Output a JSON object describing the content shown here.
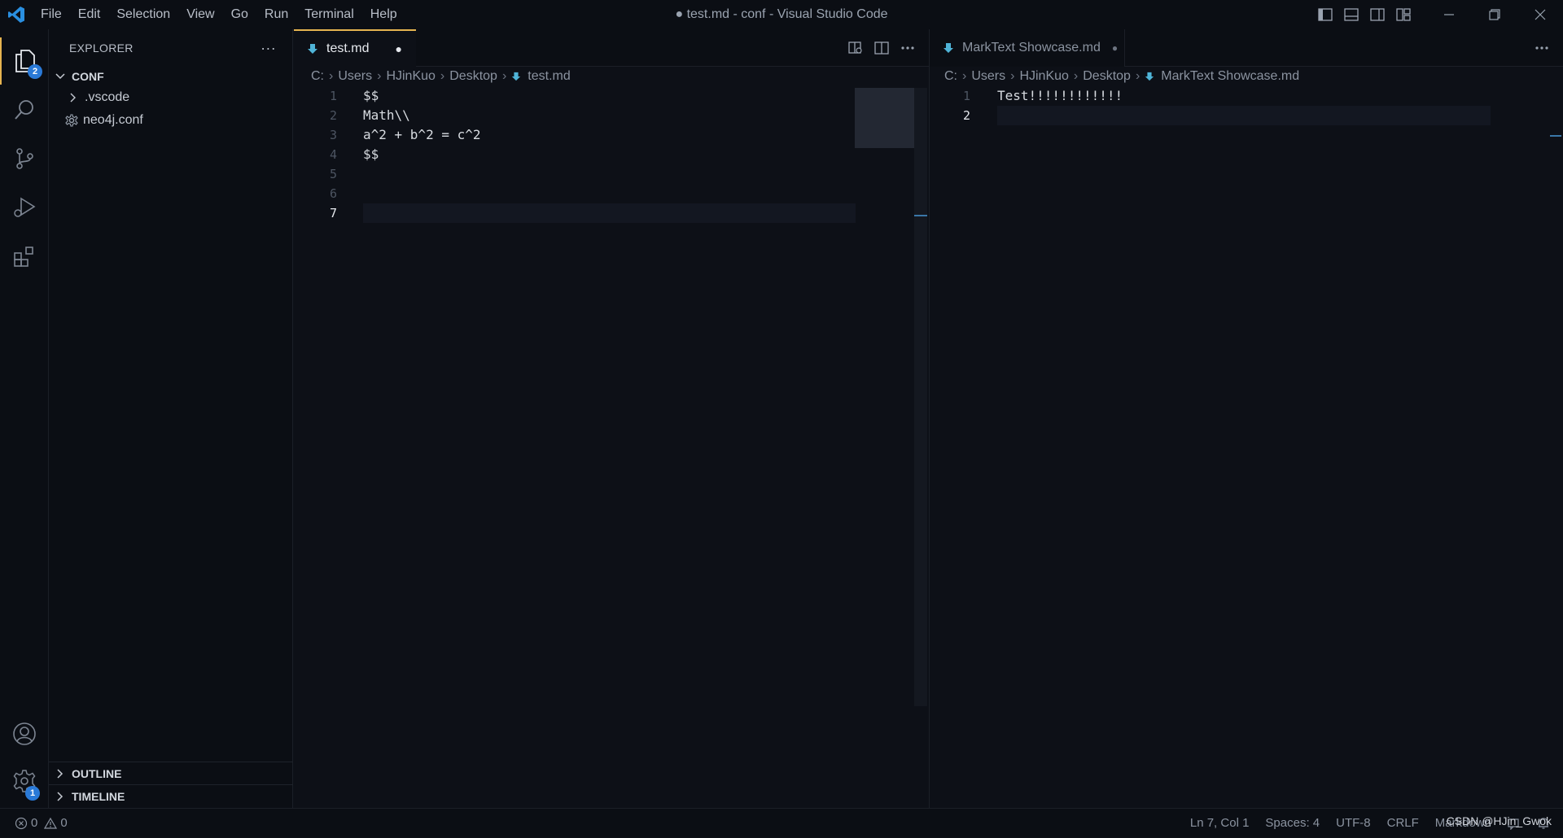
{
  "window": {
    "title": "● test.md - conf - Visual Studio Code"
  },
  "menu": [
    "File",
    "Edit",
    "Selection",
    "View",
    "Go",
    "Run",
    "Terminal",
    "Help"
  ],
  "activity": {
    "explorer_badge": "2",
    "settings_badge": "1"
  },
  "sidebar": {
    "title": "EXPLORER",
    "more_label": "···",
    "folder": "CONF",
    "items": [
      {
        "label": ".vscode",
        "type": "folder"
      },
      {
        "label": "neo4j.conf",
        "type": "file"
      }
    ],
    "outline": "OUTLINE",
    "timeline": "TIMELINE"
  },
  "left_editor": {
    "tab": {
      "label": "test.md",
      "dirty_marker": "●"
    },
    "breadcrumb": [
      "C:",
      "Users",
      "HJinKuo",
      "Desktop",
      "test.md"
    ],
    "line_numbers": [
      "1",
      "2",
      "3",
      "4",
      "5",
      "6",
      "7"
    ],
    "current_line": "7",
    "lines": [
      "$$",
      "Math\\\\",
      "a^2 + b^2 = c^2",
      "$$",
      "",
      "",
      ""
    ]
  },
  "right_editor": {
    "tab": {
      "label": "MarkText Showcase.md",
      "dirty_marker": "●"
    },
    "breadcrumb": [
      "C:",
      "Users",
      "HJinKuo",
      "Desktop",
      "MarkText Showcase.md"
    ],
    "line_numbers": [
      "1",
      "2"
    ],
    "current_line": "2",
    "lines": [
      "Test!!!!!!!!!!!!",
      ""
    ]
  },
  "statusbar": {
    "errors": "0",
    "warnings": "0",
    "position": "Ln 7, Col 1",
    "spaces": "Spaces: 4",
    "encoding": "UTF-8",
    "eol": "CRLF",
    "language": "Markdown"
  },
  "watermark": "CSDN @HJin_Gwok",
  "colors": {
    "accent": "#e6b450",
    "badge": "#2a7ad8",
    "markdown_icon": "#4fb4d8"
  }
}
